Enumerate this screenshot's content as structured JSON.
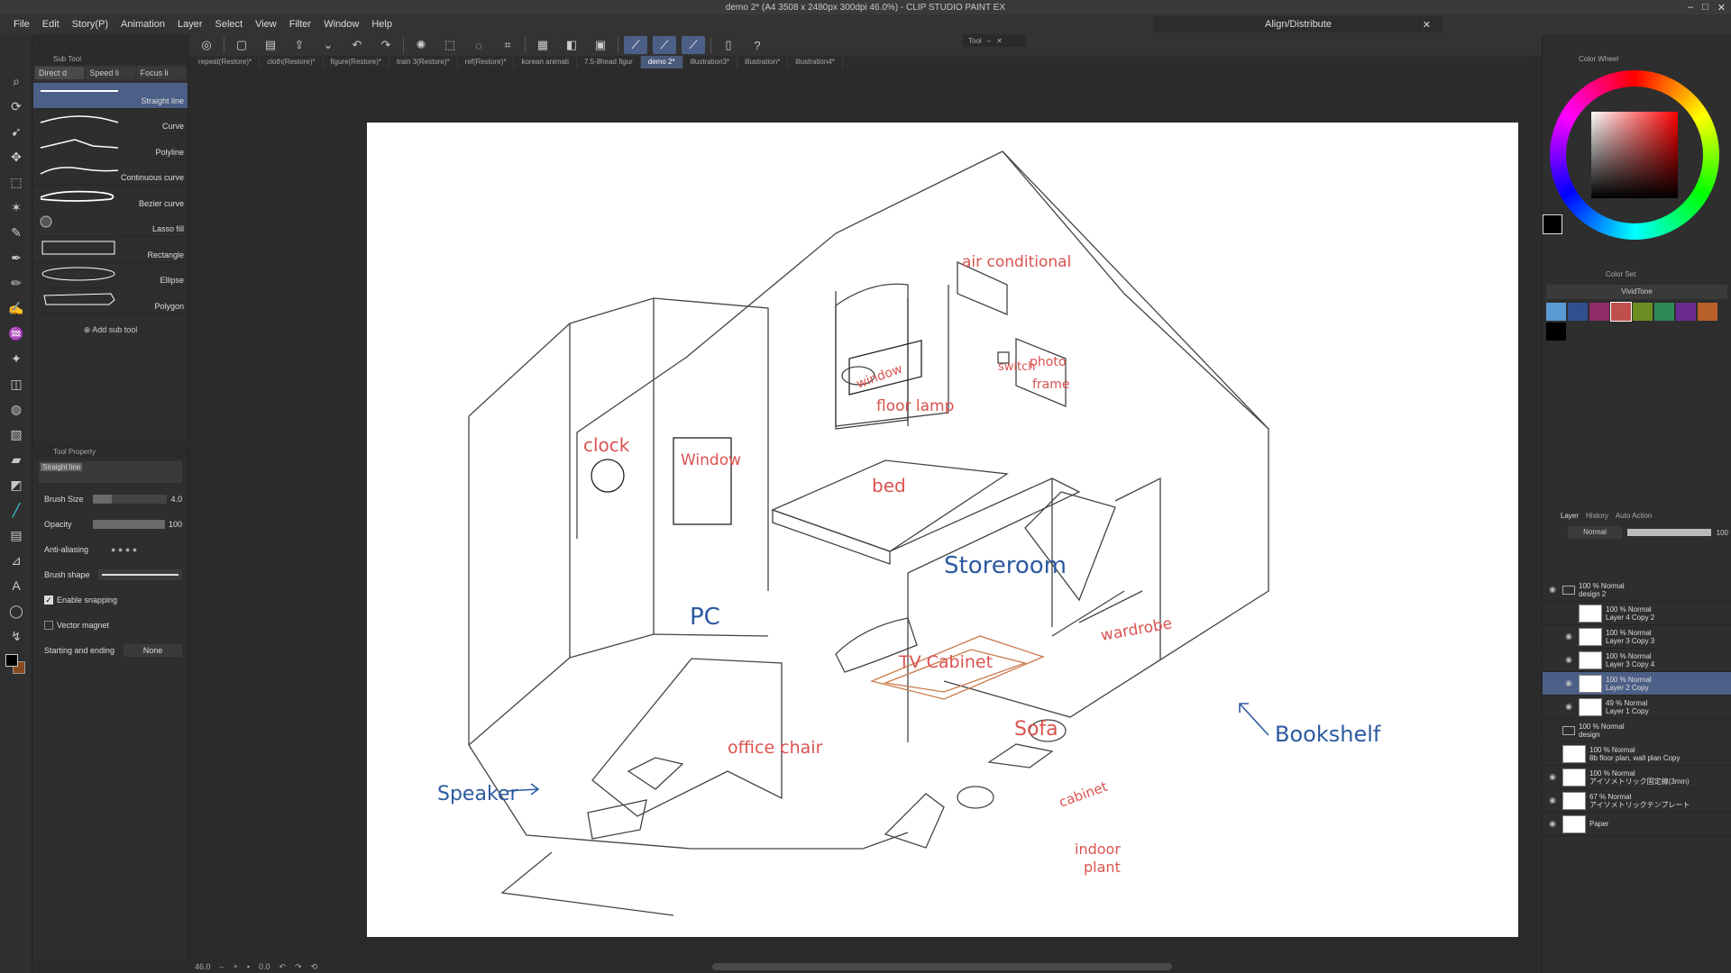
{
  "window": {
    "title": "demo 2* (A4 3508 x 2480px 300dpi 46.0%) - CLIP STUDIO PAINT EX"
  },
  "menu": [
    "File",
    "Edit",
    "Story(P)",
    "Animation",
    "Layer",
    "Select",
    "View",
    "Filter",
    "Window",
    "Help"
  ],
  "align_panel": {
    "title": "Align/Distribute"
  },
  "tool_palette_title": "Tool",
  "sub_tool": {
    "title": "Sub Tool",
    "tabs": [
      "Direct d",
      "Speed li",
      "Focus li"
    ],
    "items": [
      "Straight line",
      "Curve",
      "Polyline",
      "Continuous curve",
      "Bezier curve",
      "Lasso fill",
      "Rectangle",
      "Ellipse",
      "Polygon"
    ],
    "add_label": "Add sub tool"
  },
  "tool_property": {
    "title": "Tool Property",
    "tool_name": "Straight line",
    "brush_size_label": "Brush Size",
    "brush_size": "4.0",
    "brush_size_fill": 0.25,
    "opacity_label": "Opacity",
    "opacity": "100",
    "opacity_fill": 1.0,
    "anti_aliasing_label": "Anti-aliasing",
    "brush_shape_label": "Brush shape",
    "enable_snapping_label": "Enable snapping",
    "enable_snapping": true,
    "vector_magnet_label": "Vector magnet",
    "vector_magnet": false,
    "starting_ending_label": "Starting and ending",
    "starting_ending_value": "None"
  },
  "doc_tabs": [
    "repeat(Restore)*",
    "cloth(Restore)*",
    "figure(Restore)*",
    "train 3(Restore)*",
    "ref(Restore)*",
    "korean animati",
    "7.5-8head figur",
    "demo 2*",
    "illustration3*",
    "illustration*",
    "illustration4*"
  ],
  "active_doc_tab": "demo 2*",
  "status": {
    "zoom": "46.0",
    "angle": "0.0"
  },
  "drawing_labels": {
    "air": "air conditional",
    "switch": "switch",
    "photo": "photo",
    "frame": "frame",
    "window_right": "window",
    "floor_lamp": "floor lamp",
    "clock": "clock",
    "window_left": "Window",
    "bed": "bed",
    "storeroom": "Storeroom",
    "wardrobe": "wardrobe",
    "pc": "PC",
    "tv_cabinet": "TV Cabinet",
    "sofa": "Sofa",
    "bookshelf": "Bookshelf",
    "office_chair": "office chair",
    "speaker": "Speaker",
    "cabinet": "cabinet",
    "indoor": "indoor",
    "plant": "plant"
  },
  "colors": {
    "red_ink": "#d9534f",
    "blue_ink": "#2c5aa0",
    "accent": "#4c5f86",
    "sofa_orange": "#c97a4a"
  },
  "color_wheel": {
    "title": "Color Wheel",
    "main_color": "#000000",
    "sub_color": "#8a4a1f"
  },
  "color_set": {
    "title": "Color Set",
    "set_name": "VividTone",
    "swatches": [
      "#5b9bd5",
      "#2f4f8f",
      "#8e2c6a",
      "#c0504d",
      "#6b8e23",
      "#2e8b57",
      "#6a2c91",
      "#b8602a",
      "#000000"
    ]
  },
  "layer_panel": {
    "tabs": [
      "Layer",
      "History",
      "Auto Action"
    ],
    "blend_mode": "Normal",
    "opacity": "100",
    "layers": [
      {
        "name": "design 2",
        "mode": "100 % Normal",
        "folder": true,
        "indent": 0,
        "active": false,
        "visible": true
      },
      {
        "name": "Layer 4 Copy 2",
        "mode": "100 % Normal",
        "folder": false,
        "indent": 1,
        "active": false,
        "visible": false
      },
      {
        "name": "Layer 3 Copy 3",
        "mode": "100 % Normal",
        "folder": false,
        "indent": 1,
        "active": false,
        "visible": true
      },
      {
        "name": "Layer 3 Copy 4",
        "mode": "100 % Normal",
        "folder": false,
        "indent": 1,
        "active": false,
        "visible": true
      },
      {
        "name": "Layer 2 Copy",
        "mode": "100 % Normal",
        "folder": false,
        "indent": 1,
        "active": true,
        "visible": true
      },
      {
        "name": "Layer 1 Copy",
        "mode": "49 % Normal",
        "folder": false,
        "indent": 1,
        "active": false,
        "visible": true
      },
      {
        "name": "design",
        "mode": "100 % Normal",
        "folder": true,
        "indent": 0,
        "active": false,
        "visible": false
      },
      {
        "name": "8b floor plan, wall plan Copy",
        "mode": "100 % Normal",
        "folder": false,
        "indent": 0,
        "active": false,
        "visible": false
      },
      {
        "name": "アイソメトリック固定線(3mm)",
        "mode": "100 % Normal",
        "folder": false,
        "indent": 0,
        "active": false,
        "visible": true
      },
      {
        "name": "アイソメトリックテンプレート",
        "mode": "67 % Normal",
        "folder": false,
        "indent": 0,
        "active": false,
        "visible": true
      },
      {
        "name": "Paper",
        "mode": "",
        "folder": false,
        "indent": 0,
        "active": false,
        "visible": true
      }
    ]
  }
}
